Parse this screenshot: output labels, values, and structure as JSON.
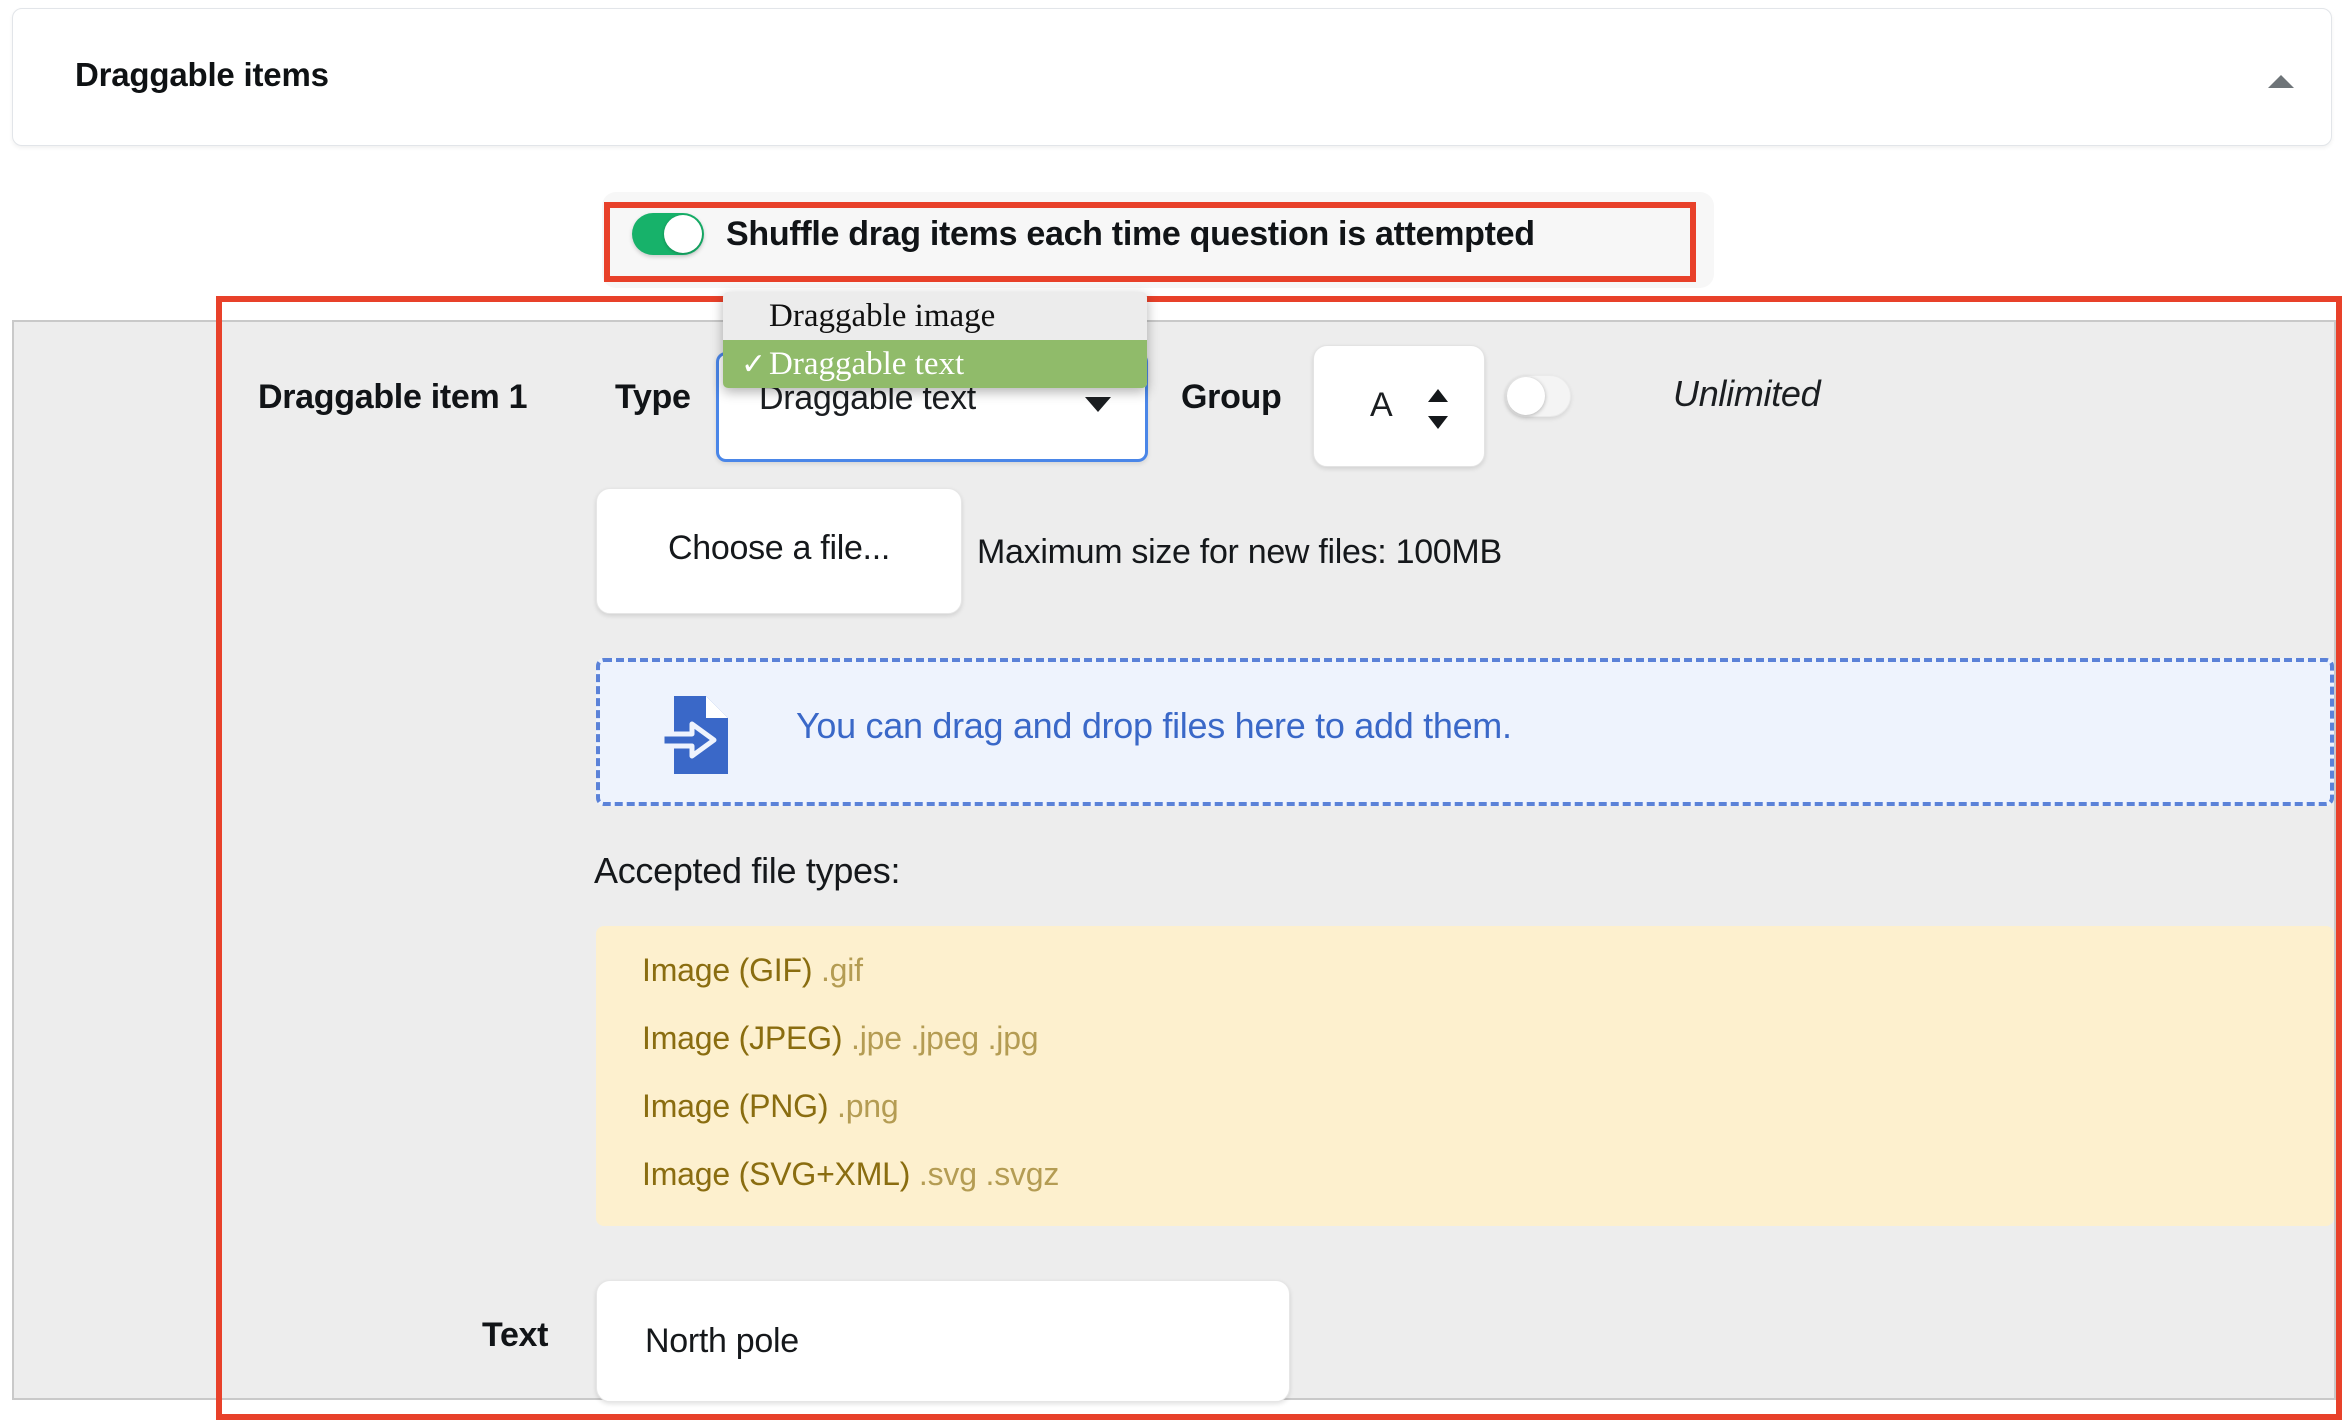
{
  "header": {
    "title": "Draggable items",
    "collapse_icon": "caret-up-icon"
  },
  "shuffle": {
    "label": "Shuffle drag items each time question is attempted",
    "toggle_state": "on",
    "highlight_color": "#e8412a"
  },
  "item": {
    "name_label": "Draggable item 1",
    "type_label": "Type",
    "type_value": "Draggable text",
    "type_options": [
      {
        "label": "Draggable image",
        "selected": false
      },
      {
        "label": "Draggable text",
        "selected": true
      }
    ],
    "group_label": "Group",
    "group_value": "A",
    "infinite_toggle_state": "off",
    "infinite_label": "Unlimited"
  },
  "file_picker": {
    "choose_label": "Choose a file...",
    "max_size_text": "Maximum size for new files: 100MB",
    "dropzone_text": "You can drag and drop files here to add them.",
    "dropzone_icon": "file-import-icon"
  },
  "accepted_types": {
    "heading": "Accepted file types:",
    "rows": [
      {
        "name": "Image (GIF)",
        "extensions": ".gif"
      },
      {
        "name": "Image (JPEG)",
        "extensions": ".jpe .jpeg .jpg"
      },
      {
        "name": "Image (PNG)",
        "extensions": ".png"
      },
      {
        "name": "Image (SVG+XML)",
        "extensions": ".svg .svgz"
      }
    ]
  },
  "text_field": {
    "label": "Text",
    "value": "North pole",
    "placeholder": ""
  },
  "colors": {
    "highlight": "#e8412a",
    "toggle_on": "#17b26a",
    "dropdown_selected": "#90bb6a",
    "dropzone_blue": "#3a68c8",
    "types_bg": "#fdf0ce"
  }
}
